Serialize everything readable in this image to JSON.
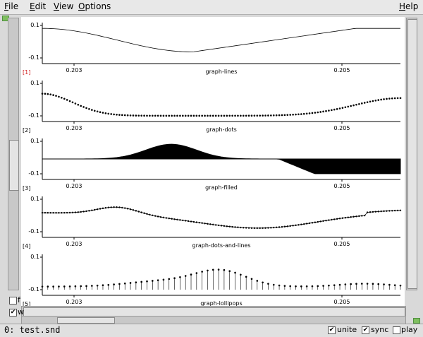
{
  "menu": {
    "file": {
      "mnemonic": "F",
      "rest": "ile"
    },
    "edit": {
      "mnemonic": "E",
      "rest": "dit"
    },
    "view": {
      "mnemonic": "V",
      "rest": "iew"
    },
    "options": {
      "mnemonic": "O",
      "rest": "ptions"
    },
    "help": {
      "mnemonic": "H",
      "rest": "elp"
    }
  },
  "graphs": [
    {
      "index_label": "[1]",
      "index_color": "#d02020",
      "style": "lines",
      "title": "graph-lines",
      "y_top": "0.1",
      "y_bottom": "-0.1",
      "x_ticks": [
        "0.203",
        "0.205"
      ]
    },
    {
      "index_label": "[2]",
      "index_color": "#000000",
      "style": "dots",
      "title": "graph-dots",
      "y_top": "0.1",
      "y_bottom": "-0.1",
      "x_ticks": [
        "0.203",
        "0.205"
      ]
    },
    {
      "index_label": "[3]",
      "index_color": "#000000",
      "style": "filled",
      "title": "graph-filled",
      "y_top": "0.1",
      "y_bottom": "-0.1",
      "x_ticks": [
        "0.203",
        "0.205"
      ]
    },
    {
      "index_label": "[4]",
      "index_color": "#000000",
      "style": "dots-and-lines",
      "title": "graph-dots-and-lines",
      "y_top": "0.1",
      "y_bottom": "-0.1",
      "x_ticks": [
        "0.203",
        "0.205"
      ]
    },
    {
      "index_label": "[5]",
      "index_color": "#000000",
      "style": "lollipops",
      "title": "graph-lollipops",
      "y_top": "0.1",
      "y_bottom": "-0.1",
      "x_ticks": [
        "0.203",
        "0.205"
      ]
    }
  ],
  "left_checks": {
    "f": "f",
    "w": "w"
  },
  "status": {
    "text": "0: test.snd",
    "unite": "unite",
    "sync": "sync",
    "play": "play"
  },
  "checks": {
    "unite": true,
    "sync": true,
    "play": false,
    "w": true,
    "f": false
  }
}
